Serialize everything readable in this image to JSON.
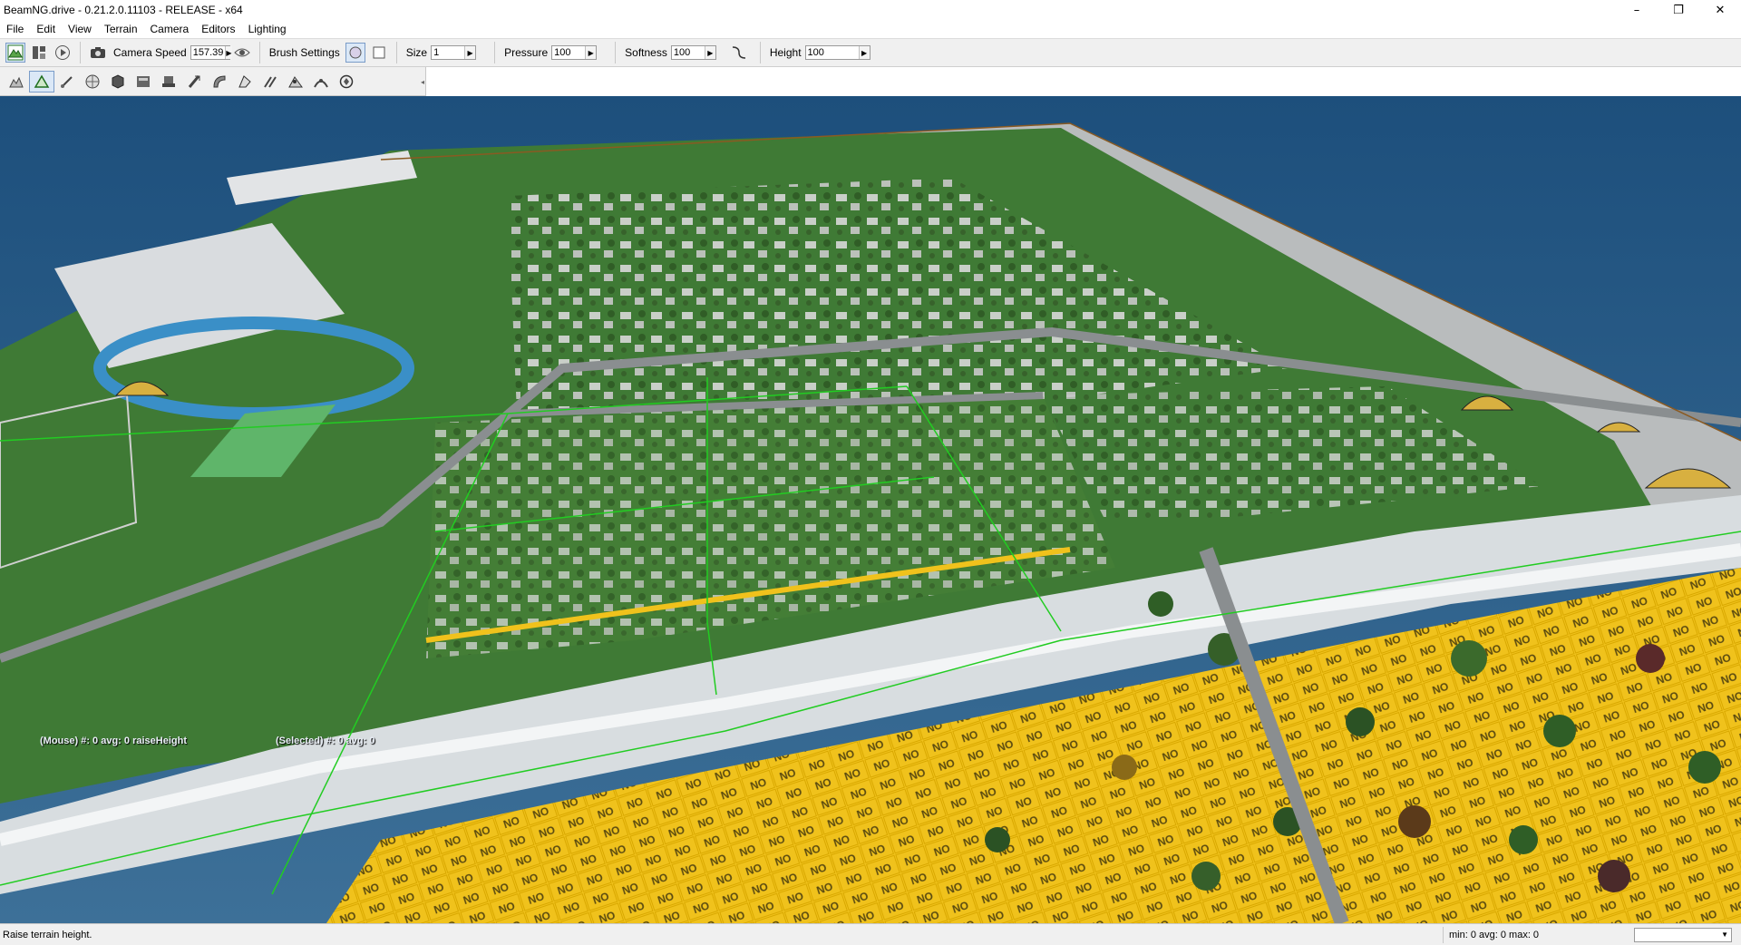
{
  "window": {
    "title": "BeamNG.drive - 0.21.2.0.11103 - RELEASE - x64",
    "minimize": "–",
    "maximize": "❐",
    "close": "✕"
  },
  "menu": [
    "File",
    "Edit",
    "View",
    "Terrain",
    "Camera",
    "Editors",
    "Lighting"
  ],
  "toolbar": {
    "camera_speed_label": "Camera Speed",
    "camera_speed_value": "157.39",
    "brush_settings_label": "Brush Settings",
    "size_label": "Size",
    "size_value": "1",
    "pressure_label": "Pressure",
    "pressure_value": "100",
    "softness_label": "Softness",
    "softness_value": "100",
    "height_label": "Height",
    "height_value": "100"
  },
  "viewport": {
    "mouse_info": "(Mouse) #: 0  avg: 0 raiseHeight",
    "selected_info": "(Selected) #: 0  avg: 0",
    "ground_label": "NO"
  },
  "status": {
    "message": "Raise terrain height.",
    "stats": "min: 0  avg: 0  max: 0",
    "dropdown_value": ""
  },
  "colors": {
    "water": "#2f5f8a",
    "grass": "#3f7a35",
    "yellow_material": "#f2c11a",
    "selection_lines": "#22cc22"
  }
}
